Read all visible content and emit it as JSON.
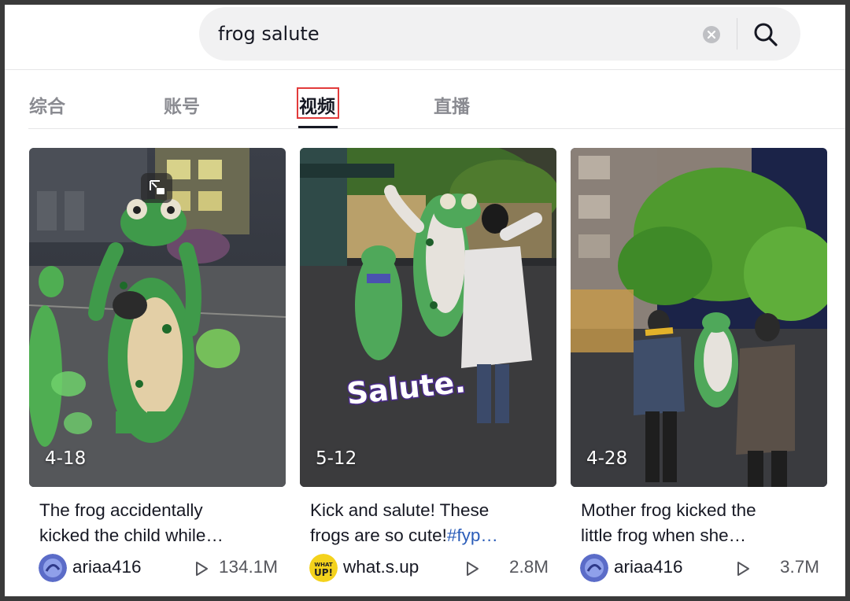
{
  "search": {
    "query": "frog salute"
  },
  "tabs": [
    {
      "label": "综合"
    },
    {
      "label": "账号"
    },
    {
      "label": "视频"
    },
    {
      "label": "直播"
    }
  ],
  "active_tab": "视频",
  "videos": [
    {
      "date": "4-18",
      "title_line1": "The frog accidentally",
      "title_line2": "kicked the child while…",
      "author": "ariaa416",
      "views": "134.1M"
    },
    {
      "date": "5-12",
      "title_line1": "Kick and salute! These",
      "title_line2_text": "frogs are so cute!",
      "title_line2_hashtag": "#fyp…",
      "overlay_text": "Salute.",
      "author": "what.s.up",
      "views": "2.8M"
    },
    {
      "date": "4-28",
      "title_line1": "Mother frog kicked the",
      "title_line2": "little frog when she…",
      "author": "ariaa416",
      "views": "3.7M"
    }
  ],
  "colors": {
    "accent_highlight": "#e23b3b",
    "hashtag": "#2b5db9",
    "text": "#161823",
    "muted": "#8a8b91"
  }
}
